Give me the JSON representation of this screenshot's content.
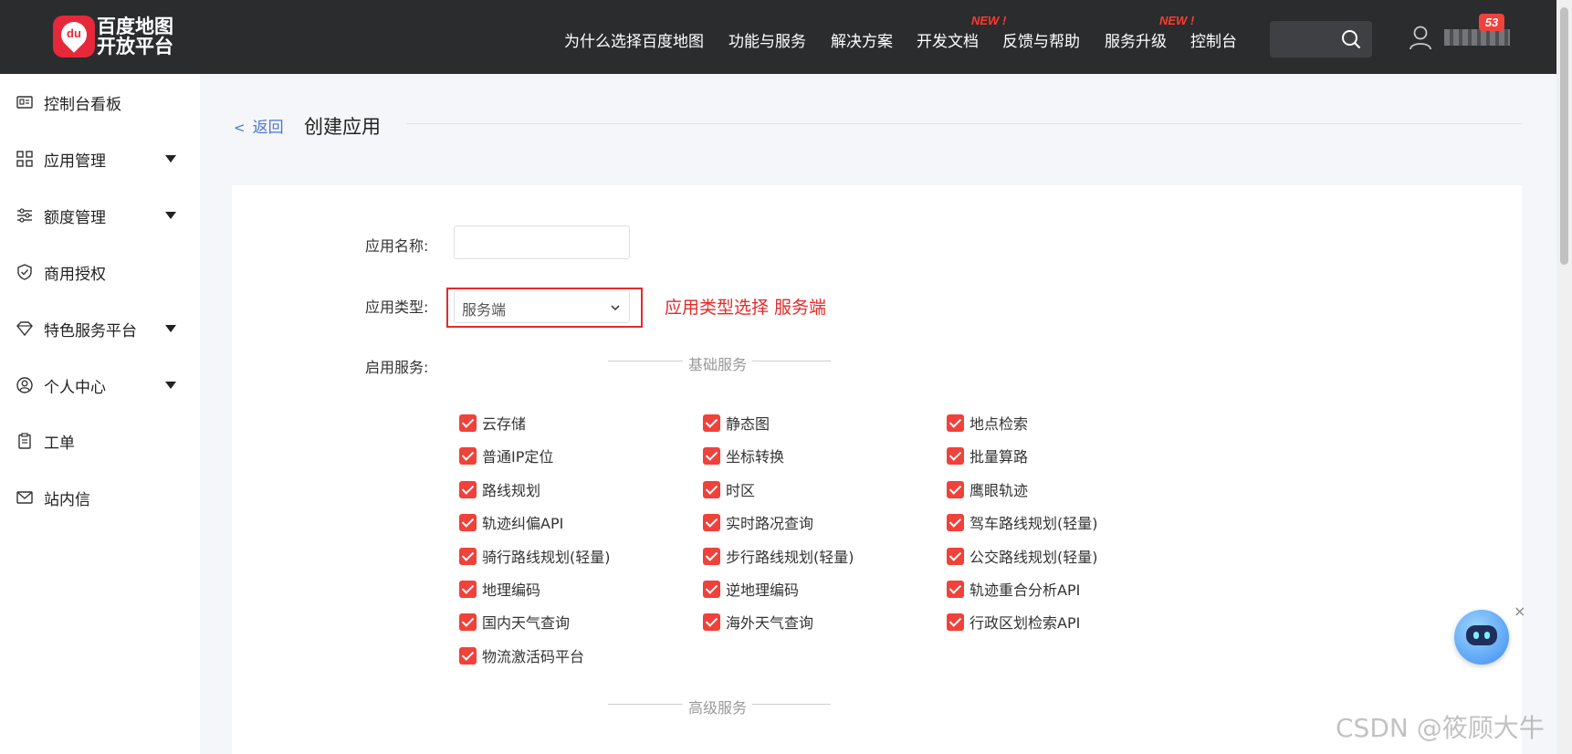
{
  "header": {
    "logo": {
      "line1": "百度地图",
      "line2": "开放平台",
      "mark": "du"
    },
    "nav": [
      {
        "label": "为什么选择百度地图",
        "new": ""
      },
      {
        "label": "功能与服务",
        "new": ""
      },
      {
        "label": "解决方案",
        "new": ""
      },
      {
        "label": "开发文档",
        "new": "NEW !"
      },
      {
        "label": "反馈与帮助",
        "new": ""
      },
      {
        "label": "服务升级",
        "new": "NEW !"
      },
      {
        "label": "控制台",
        "new": ""
      }
    ],
    "search": {
      "placeholder": "",
      "icon": "search-icon"
    },
    "user": {
      "icon": "user-icon",
      "message_count": "53"
    }
  },
  "sidebar": {
    "items": [
      {
        "label": "控制台看板",
        "icon": "dashboard-icon",
        "expandable": false
      },
      {
        "label": "应用管理",
        "icon": "grid-icon",
        "expandable": true
      },
      {
        "label": "额度管理",
        "icon": "sliders-icon",
        "expandable": true
      },
      {
        "label": "商用授权",
        "icon": "shield-check-icon",
        "expandable": false
      },
      {
        "label": "特色服务平台",
        "icon": "diamond-icon",
        "expandable": true
      },
      {
        "label": "个人中心",
        "icon": "user-circle-icon",
        "expandable": true
      },
      {
        "label": "工单",
        "icon": "clipboard-icon",
        "expandable": false
      },
      {
        "label": "站内信",
        "icon": "mail-icon",
        "expandable": false
      }
    ]
  },
  "main": {
    "back_label": "返回",
    "title": "创建应用",
    "form": {
      "name_label": "应用名称:",
      "name_value": "",
      "type_label": "应用类型:",
      "type_value": "服务端",
      "services_label": "启用服务:"
    },
    "annotation": "应用类型选择 服务端",
    "basic_title": "基础服务",
    "advanced_title": "高级服务",
    "services": [
      [
        "云存储",
        "静态图",
        "地点检索"
      ],
      [
        "普通IP定位",
        "坐标转换",
        "批量算路"
      ],
      [
        "路线规划",
        "时区",
        "鹰眼轨迹"
      ],
      [
        "轨迹纠偏API",
        "实时路况查询",
        "驾车路线规划(轻量)"
      ],
      [
        "骑行路线规划(轻量)",
        "步行路线规划(轻量)",
        "公交路线规划(轻量)"
      ],
      [
        "地理编码",
        "逆地理编码",
        "轨迹重合分析API"
      ],
      [
        "国内天气查询",
        "海外天气查询",
        "行政区划检索API"
      ],
      [
        "物流激活码平台"
      ]
    ],
    "all_checked": true
  },
  "assistant": {
    "icon": "robot-icon",
    "close": "×"
  },
  "watermark": "CSDN @筱顾大牛",
  "colors": {
    "header_bg": "#2b2c2e",
    "accent_red": "#f0413a",
    "link_blue": "#4a76d6",
    "page_bg": "#f5f6fa"
  }
}
